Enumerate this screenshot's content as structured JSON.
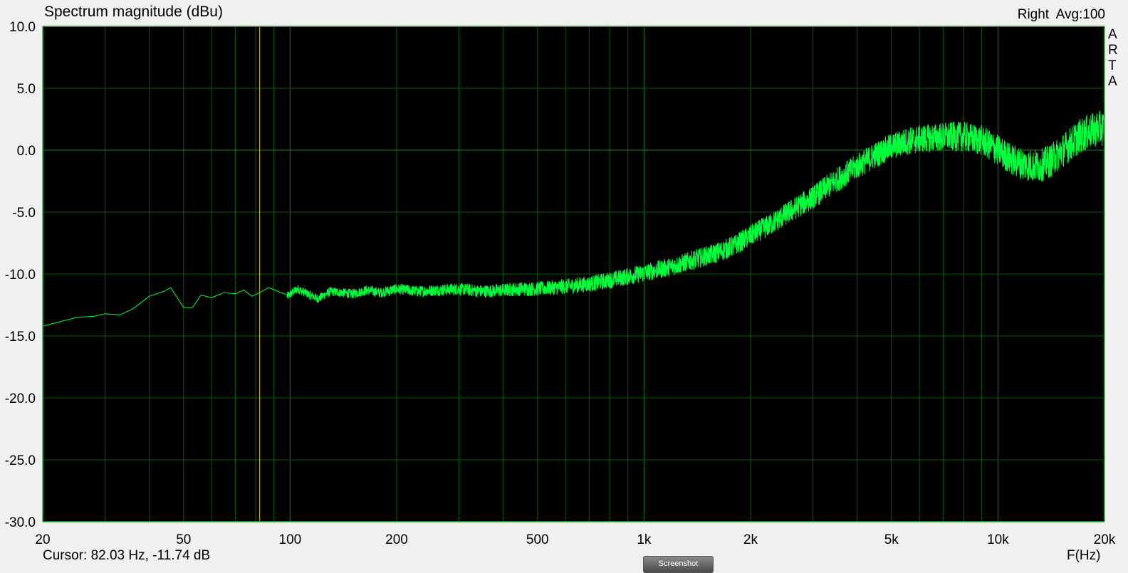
{
  "header": {
    "title": "Spectrum magnitude (dBu)",
    "channel": "Right",
    "averaging": "Avg:100",
    "side_letters": [
      "A",
      "R",
      "T",
      "A"
    ]
  },
  "footer": {
    "cursor_readout": "Cursor: 82.03 Hz, -11.74 dB",
    "x_unit": "F(Hz)",
    "screenshot_button": "Screenshot"
  },
  "colors": {
    "plot_background": "#000000",
    "grid": "#0b5c0b",
    "trace": "#00ff3c",
    "cursor_line": "#e0c000",
    "frame": "#1f8f1f"
  },
  "chart_data": {
    "type": "line",
    "title": "Spectrum magnitude (dBu)",
    "xlabel": "F(Hz)",
    "ylabel": "",
    "x_scale": "log",
    "xlim": [
      20,
      20000
    ],
    "ylim": [
      -30,
      10
    ],
    "y_ticks": [
      10,
      5,
      0,
      -5,
      -10,
      -15,
      -20,
      -25,
      -30
    ],
    "y_tick_labels": [
      "10.0",
      "5.0",
      "0.0",
      "-5.0",
      "-10.0",
      "-15.0",
      "-20.0",
      "-25.0",
      "-30.0"
    ],
    "x_ticks": [
      20,
      50,
      100,
      200,
      500,
      1000,
      2000,
      5000,
      10000,
      20000
    ],
    "x_tick_labels": [
      "20",
      "50",
      "100",
      "200",
      "500",
      "1k",
      "2k",
      "5k",
      "10k",
      "20k"
    ],
    "grid": true,
    "cursor": {
      "x": 82.03,
      "y": -11.74
    },
    "series": [
      {
        "x": [
          20,
          22,
          25,
          28,
          30,
          33,
          36,
          40,
          44,
          46,
          50,
          53,
          56,
          60,
          65,
          70,
          74,
          78,
          82,
          87,
          93,
          98,
          105,
          112,
          120,
          130,
          140,
          150,
          165,
          180,
          200,
          230,
          260,
          300,
          350,
          400,
          450,
          500,
          600,
          700,
          800,
          900,
          1000,
          1200,
          1400,
          1600,
          1800,
          2000,
          2300,
          2600,
          3000,
          3500,
          4000,
          4500,
          5000,
          5500,
          6000,
          7000,
          8000,
          9000,
          10000,
          11000,
          12000,
          13000,
          14000,
          15000,
          16000,
          17000,
          18000,
          19000,
          20000
        ],
        "y": [
          -14.2,
          -13.9,
          -13.5,
          -13.4,
          -13.2,
          -13.3,
          -12.8,
          -11.8,
          -11.4,
          -11.1,
          -12.7,
          -12.7,
          -11.7,
          -11.9,
          -11.5,
          -11.6,
          -11.3,
          -11.8,
          -11.5,
          -11.1,
          -12.8,
          -11.8,
          -11.2,
          -11.6,
          -12.0,
          -11.4,
          -11.5,
          -11.6,
          -11.3,
          -11.5,
          -11.2,
          -11.4,
          -11.3,
          -11.2,
          -11.4,
          -11.3,
          -11.2,
          -11.2,
          -11.0,
          -10.8,
          -10.5,
          -10.2,
          -9.9,
          -9.4,
          -8.8,
          -8.3,
          -7.7,
          -6.9,
          -5.9,
          -4.9,
          -3.8,
          -2.4,
          -1.3,
          -0.4,
          0.3,
          0.7,
          0.9,
          1.1,
          1.1,
          0.8,
          0.0,
          -0.8,
          -1.2,
          -1.3,
          -0.9,
          -0.2,
          0.5,
          1.1,
          1.5,
          1.7,
          1.8
        ]
      }
    ]
  }
}
